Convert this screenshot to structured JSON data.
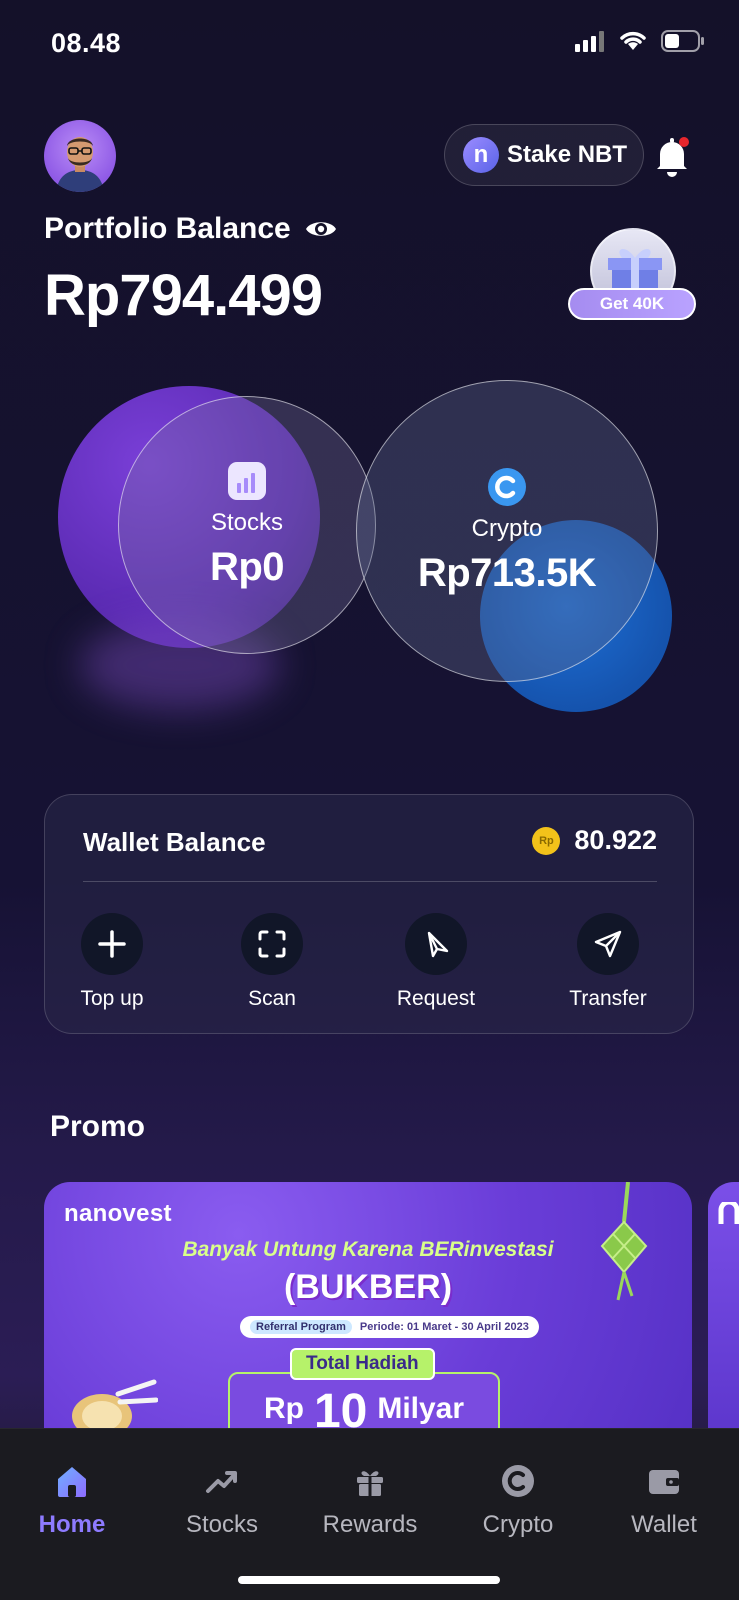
{
  "status_bar": {
    "time": "08.48"
  },
  "header": {
    "stake_label": "Stake NBT",
    "stake_logo_letter": "n"
  },
  "portfolio": {
    "title": "Portfolio Balance",
    "value": "Rp794.499",
    "reward_label": "Get 40K"
  },
  "assets": {
    "stocks": {
      "label": "Stocks",
      "value": "Rp0"
    },
    "crypto": {
      "label": "Crypto",
      "value": "Rp713.5K"
    }
  },
  "wallet": {
    "title": "Wallet Balance",
    "coin_symbol": "Rp",
    "amount": "80.922",
    "actions": [
      {
        "label": "Top up"
      },
      {
        "label": "Scan"
      },
      {
        "label": "Request"
      },
      {
        "label": "Transfer"
      }
    ]
  },
  "promo": {
    "title": "Promo",
    "brand": "nanovest",
    "headline": "Banyak Untung Karena BERinvestasi",
    "subheadline": "(BUKBER)",
    "referral_tag": "Referral Program",
    "period": "Periode: 01 Maret - 30 April 2023",
    "prize_tag": "Total Hadiah",
    "prize_currency": "Rp",
    "prize_number": "10",
    "prize_unit": "Milyar"
  },
  "nav": {
    "items": [
      {
        "label": "Home",
        "icon": "home-icon",
        "active": true
      },
      {
        "label": "Stocks",
        "icon": "trend-up-icon"
      },
      {
        "label": "Rewards",
        "icon": "gift-icon"
      },
      {
        "label": "Crypto",
        "icon": "crypto-icon"
      },
      {
        "label": "Wallet",
        "icon": "wallet-icon"
      }
    ]
  },
  "colors": {
    "accent": "#8e7bff",
    "background": "#141129",
    "crypto_blue": "#1e6fd6",
    "stocks_purple": "#7a3fd8",
    "coin_gold": "#f2c21a"
  }
}
